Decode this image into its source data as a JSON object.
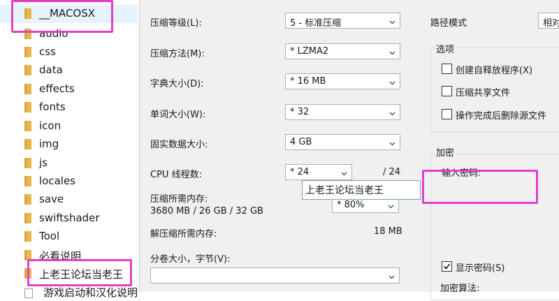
{
  "file_list": {
    "items": [
      {
        "name": "__MACOSX",
        "type": "folder"
      },
      {
        "name": "audio",
        "type": "folder"
      },
      {
        "name": "css",
        "type": "folder"
      },
      {
        "name": "data",
        "type": "folder"
      },
      {
        "name": "effects",
        "type": "folder"
      },
      {
        "name": "fonts",
        "type": "folder"
      },
      {
        "name": "icon",
        "type": "folder"
      },
      {
        "name": "img",
        "type": "folder"
      },
      {
        "name": "js",
        "type": "folder"
      },
      {
        "name": "locales",
        "type": "folder"
      },
      {
        "name": "save",
        "type": "folder"
      },
      {
        "name": "swiftshader",
        "type": "folder"
      },
      {
        "name": "Tool",
        "type": "folder"
      },
      {
        "name": "必看说明",
        "type": "folder"
      },
      {
        "name": "上老王论坛当老王",
        "type": "folder"
      },
      {
        "name": "游戏启动和汉化说明",
        "type": "file"
      }
    ]
  },
  "compression": {
    "level_label": "压缩等级(L):",
    "level_value": "5 - 标准压缩",
    "method_label": "压缩方法(M):",
    "method_value": "* LZMA2",
    "dict_label": "字典大小(D):",
    "dict_value": "* 16 MB",
    "word_label": "单词大小(W):",
    "word_value": "* 32",
    "solid_label": "固实数据大小:",
    "solid_value": "4 GB",
    "cpu_label": "CPU 线程数:",
    "cpu_value": "* 24",
    "cpu_total": "/ 24",
    "mem_label": "压缩所需内存:",
    "mem_value": "3680 MB / 26 GB / 32 GB",
    "mem_percent": "* 80%",
    "decomp_label": "解压缩所需内存:",
    "decomp_value": "18 MB",
    "split_label": "分卷大小，字节(V):",
    "split_value": ""
  },
  "right_panel": {
    "path_mode_label": "路径模式",
    "path_mode_value": "相对",
    "options_title": "选项",
    "opt_sfx": "创建自释放程序(X)",
    "opt_shared": "压缩共享文件",
    "opt_delete": "操作完成后删除源文件",
    "encryption_title": "加密",
    "password_label": "输入密码:",
    "password_value": "上老王论坛当老王",
    "show_password": "显示密码(S)",
    "encrypt_method_label": "加密算法:"
  },
  "colors": {
    "highlight": "#e040c8",
    "folder": "#e8b64a"
  }
}
